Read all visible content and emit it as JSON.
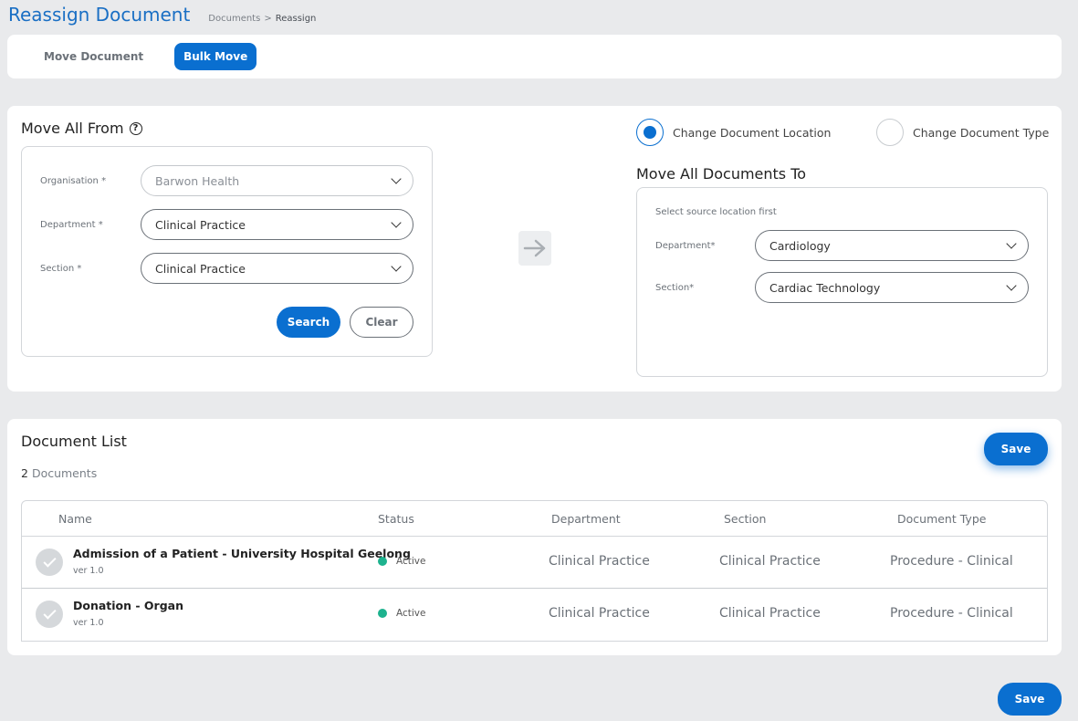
{
  "header": {
    "title": "Reassign Document",
    "breadcrumb": [
      "Documents",
      ">",
      "Reassign"
    ]
  },
  "tabs": [
    {
      "label": "Move Document",
      "active": false
    },
    {
      "label": "Bulk Move",
      "active": true
    }
  ],
  "move_from": {
    "title": "Move All From",
    "help_icon": "question-circle-icon",
    "fields": [
      {
        "label": "Organisation *",
        "value": "Barwon Health",
        "disabled": true
      },
      {
        "label": "Department *",
        "value": "Clinical Practice",
        "disabled": false
      },
      {
        "label": "Section *",
        "value": "Clinical Practice",
        "disabled": false
      }
    ],
    "search_label": "Search",
    "clear_label": "Clear"
  },
  "arrow_icon": "arrow-right-icon",
  "change_options": [
    {
      "label": "Change Document Location",
      "checked": true
    },
    {
      "label": "Change Document Type",
      "checked": false
    }
  ],
  "move_to": {
    "title": "Move All Documents To",
    "hint": "Select source location first",
    "fields": [
      {
        "label": "Department*",
        "value": "Cardiology"
      },
      {
        "label": "Section*",
        "value": "Cardiac Technology"
      }
    ]
  },
  "document_list": {
    "title": "Document List",
    "count": "2",
    "count_label": "Documents",
    "save_label": "Save",
    "columns": [
      "Name",
      "Status",
      "Department",
      "Section",
      "Document Type"
    ],
    "rows": [
      {
        "name": "Admission of a Patient - University Hospital Geelong",
        "version": "ver 1.0",
        "status": "Active",
        "department": "Clinical Practice",
        "section": "Clinical Practice",
        "document_type": "Procedure - Clinical"
      },
      {
        "name": "Donation - Organ",
        "version": "ver 1.0",
        "status": "Active",
        "department": "Clinical Practice",
        "section": "Clinical Practice",
        "document_type": "Procedure - Clinical"
      }
    ]
  },
  "footer": {
    "save_label": "Save"
  },
  "colors": {
    "accent": "#0a6fd0",
    "active_status": "#1db28e",
    "title": "#1a6fc4"
  }
}
